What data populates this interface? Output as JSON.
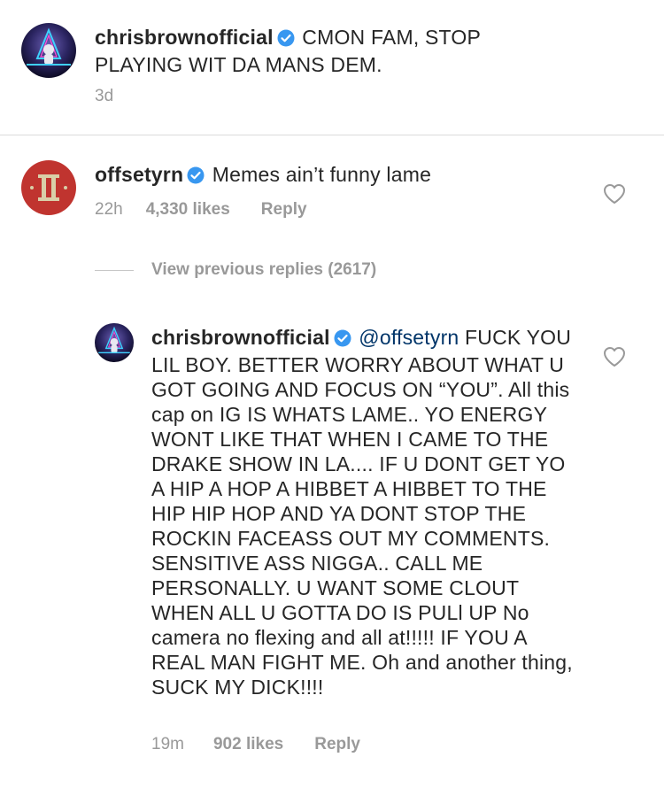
{
  "caption": {
    "username": "chrisbrownofficial",
    "text": "CMON FAM, STOP PLAYING WIT DA MANS DEM.",
    "time": "3d",
    "avatar_icon": "astronaut-avatar-icon",
    "verified_icon": "verified-badge-icon"
  },
  "comments": [
    {
      "username": "offsetyrn",
      "text": "Memes ain’t funny lame",
      "time": "22h",
      "likes": "4,330 likes",
      "reply": "Reply",
      "avatar_icon": "roman-numeral-avatar-icon"
    }
  ],
  "view_previous": "View previous replies (2617)",
  "replies": [
    {
      "username": "chrisbrownofficial",
      "mention": "@offsetyrn",
      "text": "FUCK YOU LIL BOY. BETTER WORRY ABOUT WHAT U GOT GOING AND FOCUS ON “YOU”. All this cap on IG IS WHATS LAME.. YO ENERGY WONT LIKE THAT WHEN I CAME TO THE DRAKE SHOW IN LA.... IF U DONT  GET YO A HIP A HOP A HIBBET A HIBBET TO THE HIP HIP HOP AND YA DONT STOP THE ROCKIN FACEASS OUT MY COMMENTS. SENSITIVE ASS NIGGA.. CALL ME PERSONALLY. U WANT SOME CLOUT WHEN ALL U GOTTA DO IS PULl UP No camera no flexing and all at!!!!! IF YOU A REAL MAN FIGHT ME. Oh and another thing,  SUCK MY DICK!!!!",
      "time": "19m",
      "likes": "902 likes",
      "reply": "Reply"
    }
  ],
  "colors": {
    "text": "#262626",
    "secondary": "#999999",
    "verified": "#3897f0",
    "mention": "#003569",
    "divider": "#dbdbdb"
  }
}
